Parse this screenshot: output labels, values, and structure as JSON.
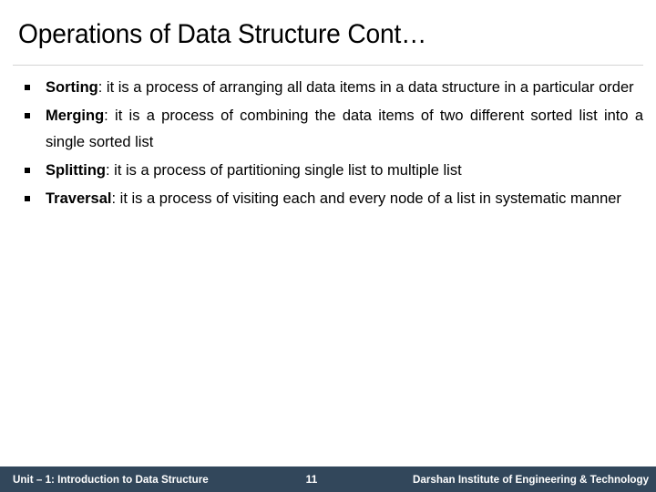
{
  "slide": {
    "title": "Operations of Data Structure Cont…",
    "bullets": [
      {
        "bullet_glyph": "square-bullet",
        "term": "Sorting",
        "separator": ":",
        "description": " it is a process of arranging all data items in a data structure in a particular order"
      },
      {
        "bullet_glyph": "square-bullet",
        "term": "Merging",
        "separator": ":",
        "description": " it is a process of combining the data items of two different sorted list into a single sorted list"
      },
      {
        "bullet_glyph": "square-bullet",
        "term": "Splitting",
        "separator": ":",
        "description": " it is a process of partitioning single list to multiple list"
      },
      {
        "bullet_glyph": "square-bullet",
        "term": "Traversal",
        "separator": ":",
        "description": " it is a process of visiting each and every node of a list in systematic manner"
      }
    ]
  },
  "footer": {
    "left_text": "Unit – 1: Introduction to Data Structure",
    "page_number": "11",
    "right_text": "Darshan Institute of Engineering & Technology",
    "background_color": "#32475b",
    "text_color": "#ffffff"
  },
  "theme": {
    "title_color": "#000000",
    "body_color": "#000000",
    "rule_color": "#d4d4d4",
    "background_color": "#ffffff"
  }
}
